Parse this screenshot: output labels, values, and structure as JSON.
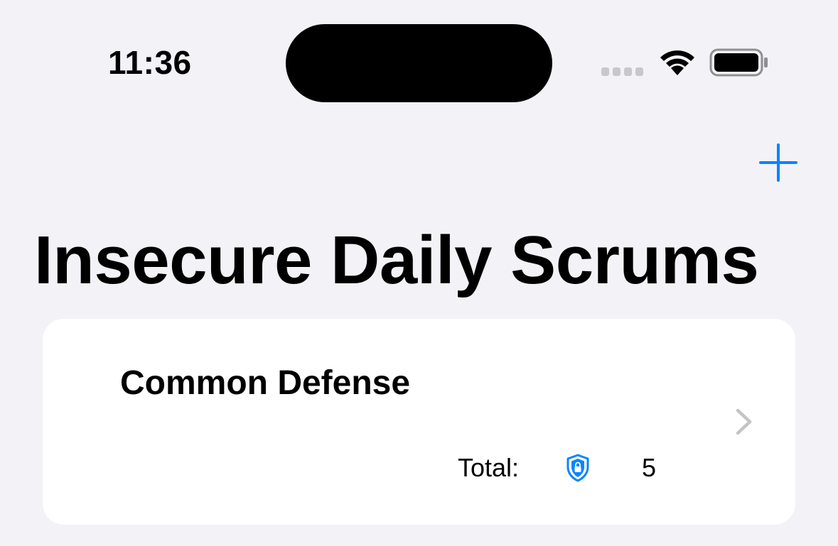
{
  "status_bar": {
    "time": "11:36"
  },
  "nav": {
    "add_icon": "plus-icon",
    "title": "Insecure Daily Scrums"
  },
  "scrums": [
    {
      "title": "Common Defense",
      "total_label": "Total:",
      "total_icon": "lock-shield-icon",
      "total_value": "5"
    }
  ],
  "colors": {
    "accent": "#0a84ff",
    "background": "#f2f2f7",
    "card": "#ffffff",
    "chevron": "#c4c4c7"
  }
}
